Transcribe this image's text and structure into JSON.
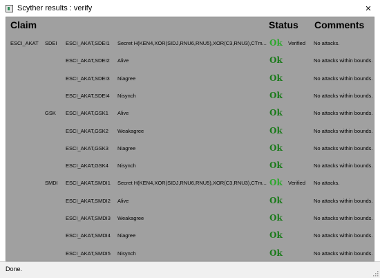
{
  "window": {
    "title": "Scyther results : verify",
    "close_icon": "×"
  },
  "headers": {
    "claim": "Claim",
    "status": "Status",
    "comments": "Comments"
  },
  "rows": [
    {
      "protocol": "ESCI_AKAT",
      "role": "SDEI",
      "id": "ESCI_AKAT,SDEI1",
      "claim": "Secret H(KEN4,XOR(SIDJ,RNU6,RNU5),XOR(C3,RNU3),CTm...",
      "status": "Ok",
      "verified": "Verified",
      "comment": "No attacks.",
      "bright": true
    },
    {
      "protocol": "",
      "role": "",
      "id": "ESCI_AKAT,SDEI2",
      "claim": "Alive",
      "status": "Ok",
      "verified": "",
      "comment": "No attacks within bounds.",
      "bright": false
    },
    {
      "protocol": "",
      "role": "",
      "id": "ESCI_AKAT,SDEI3",
      "claim": "Niagree",
      "status": "Ok",
      "verified": "",
      "comment": "No attacks within bounds.",
      "bright": false
    },
    {
      "protocol": "",
      "role": "",
      "id": "ESCI_AKAT,SDEI4",
      "claim": "Nisynch",
      "status": "Ok",
      "verified": "",
      "comment": "No attacks within bounds.",
      "bright": false
    },
    {
      "protocol": "",
      "role": "GSK",
      "id": "ESCI_AKAT,GSK1",
      "claim": "Alive",
      "status": "Ok",
      "verified": "",
      "comment": "No attacks within bounds.",
      "bright": false
    },
    {
      "protocol": "",
      "role": "",
      "id": "ESCI_AKAT,GSK2",
      "claim": "Weakagree",
      "status": "Ok",
      "verified": "",
      "comment": "No attacks within bounds.",
      "bright": false
    },
    {
      "protocol": "",
      "role": "",
      "id": "ESCI_AKAT,GSK3",
      "claim": "Niagree",
      "status": "Ok",
      "verified": "",
      "comment": "No attacks within bounds.",
      "bright": false
    },
    {
      "protocol": "",
      "role": "",
      "id": "ESCI_AKAT,GSK4",
      "claim": "Nisynch",
      "status": "Ok",
      "verified": "",
      "comment": "No attacks within bounds.",
      "bright": false
    },
    {
      "protocol": "",
      "role": "SMDI",
      "id": "ESCI_AKAT,SMDI1",
      "claim": "Secret H(KEN4,XOR(SIDJ,RNU6,RNU5),XOR(C3,RNU3),CTm...",
      "status": "Ok",
      "verified": "Verified",
      "comment": "No attacks.",
      "bright": true
    },
    {
      "protocol": "",
      "role": "",
      "id": "ESCI_AKAT,SMDI2",
      "claim": "Alive",
      "status": "Ok",
      "verified": "",
      "comment": "No attacks within bounds.",
      "bright": false
    },
    {
      "protocol": "",
      "role": "",
      "id": "ESCI_AKAT,SMDI3",
      "claim": "Weakagree",
      "status": "Ok",
      "verified": "",
      "comment": "No attacks within bounds.",
      "bright": false
    },
    {
      "protocol": "",
      "role": "",
      "id": "ESCI_AKAT,SMDI4",
      "claim": "Niagree",
      "status": "Ok",
      "verified": "",
      "comment": "No attacks within bounds.",
      "bright": false
    },
    {
      "protocol": "",
      "role": "",
      "id": "ESCI_AKAT,SMDI5",
      "claim": "Nisynch",
      "status": "Ok",
      "verified": "",
      "comment": "No attacks within bounds.",
      "bright": false
    }
  ],
  "statusbar": {
    "text": "Done."
  },
  "colors": {
    "panel_bg": "#a0a0a0",
    "ok_green": "#1a7a1a",
    "ok_bright_green": "#2ea82e"
  }
}
